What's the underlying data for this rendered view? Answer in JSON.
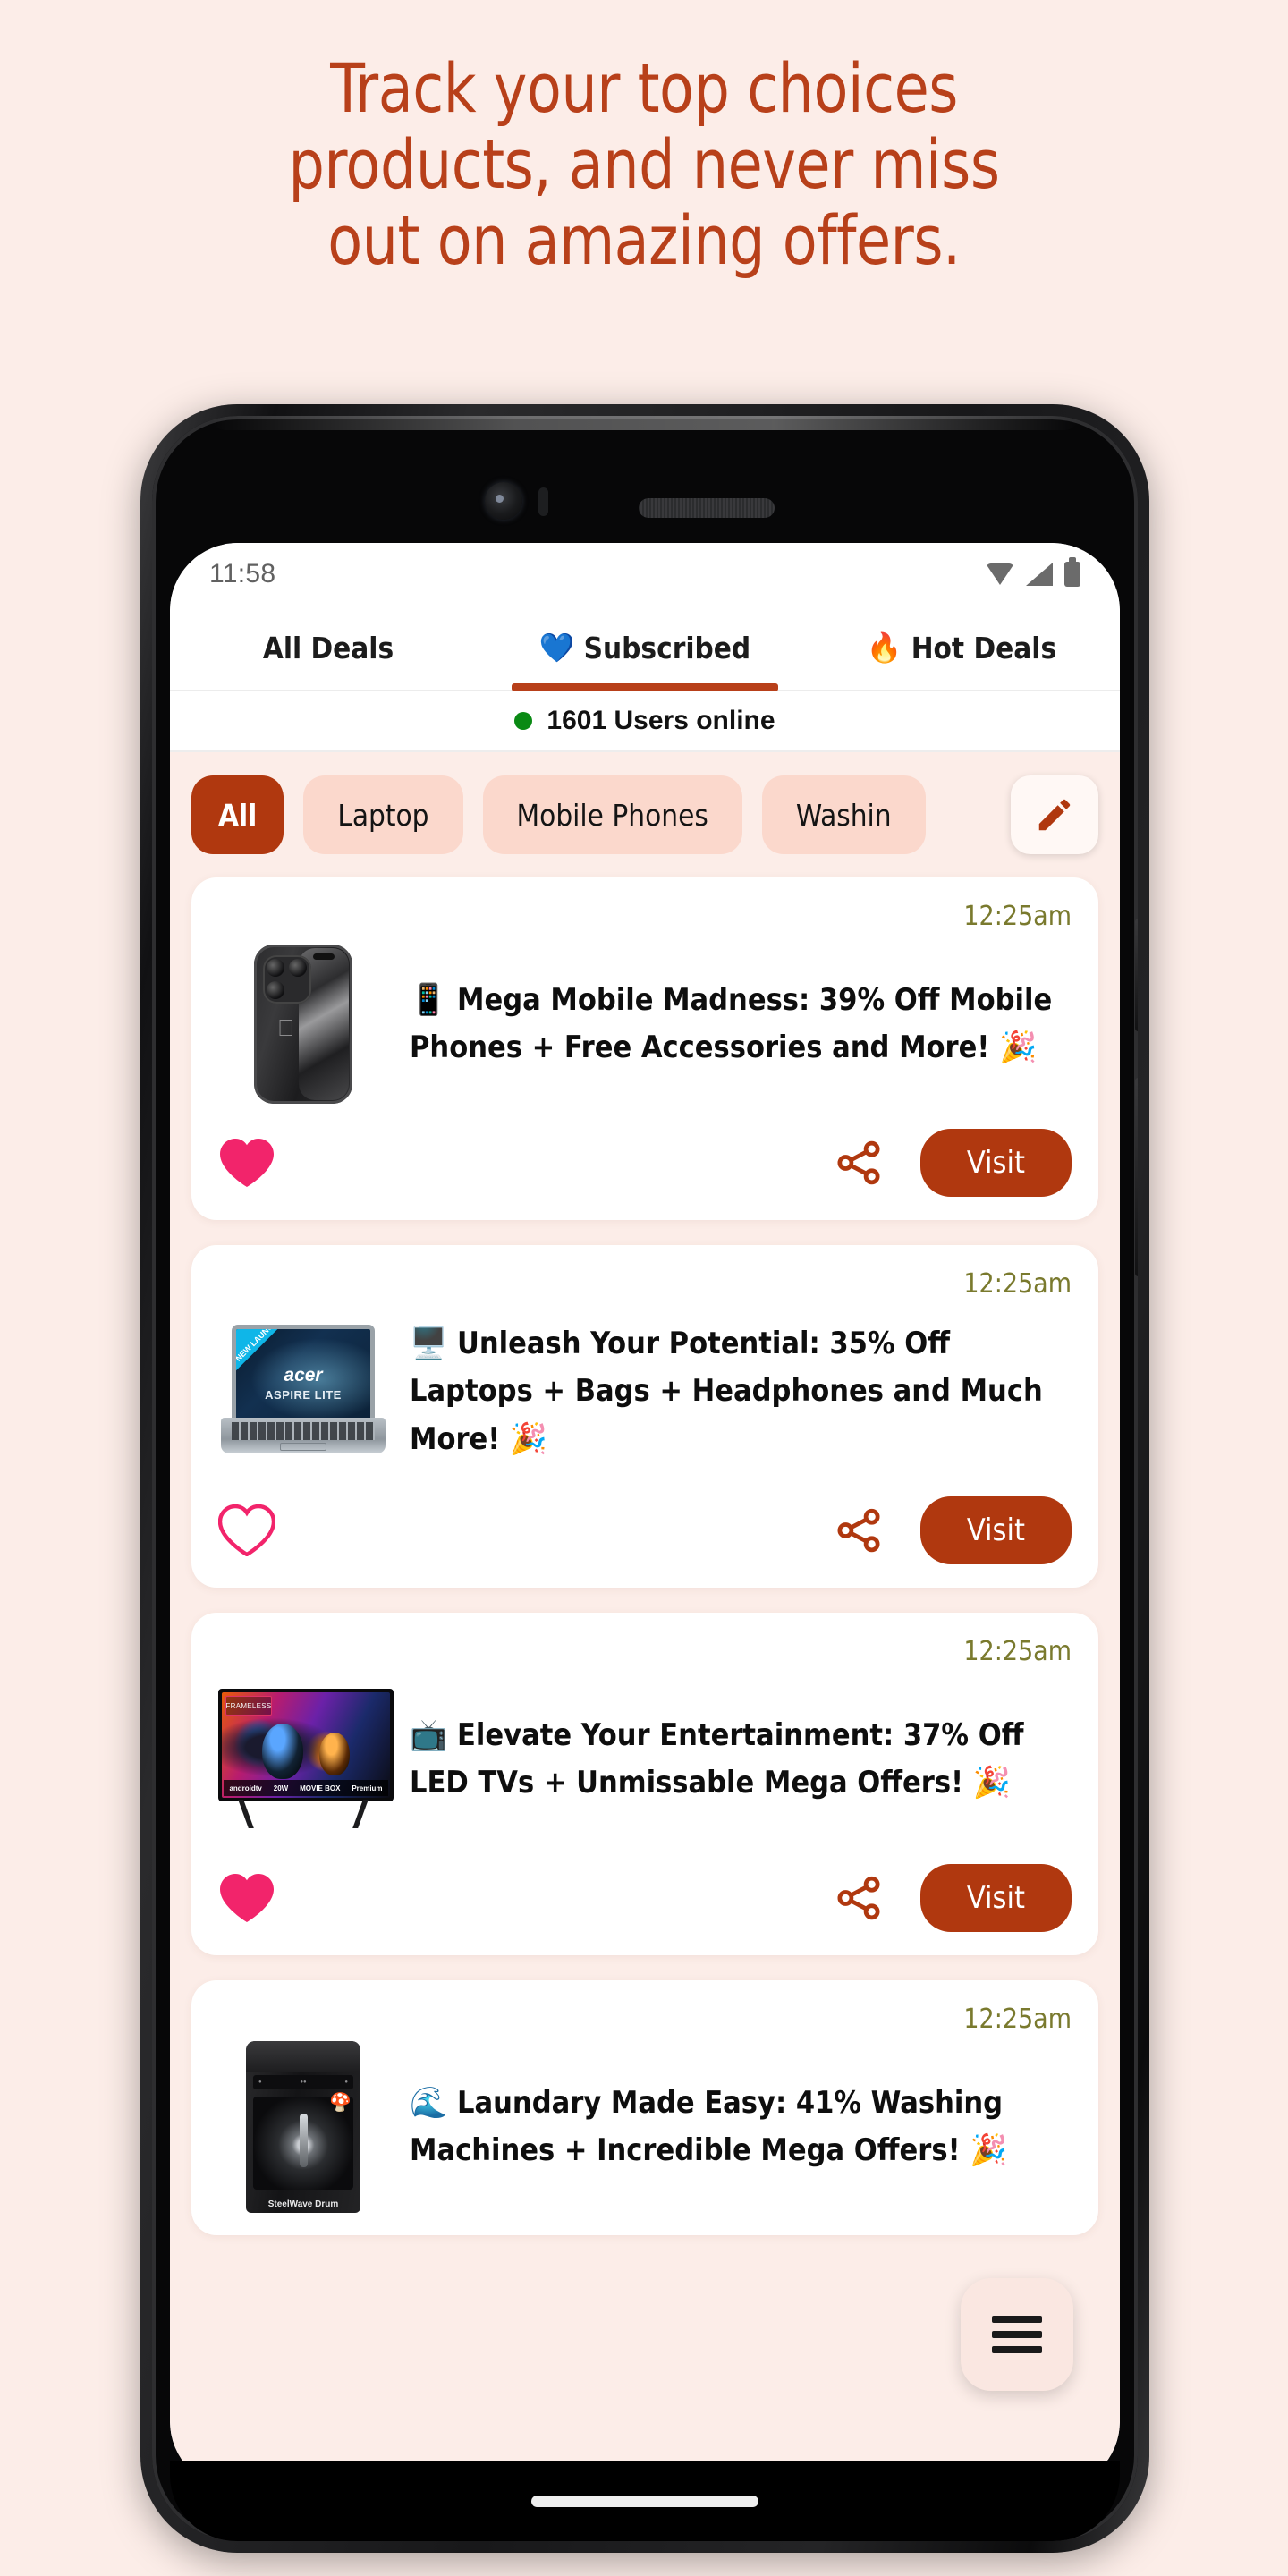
{
  "promo": {
    "headline_lines": [
      "Track your top choices",
      "products, and never miss",
      "out on amazing offers."
    ],
    "headline_color": "#B8401A",
    "background_color": "#FCEDE8"
  },
  "status_bar": {
    "time": "11:58",
    "icons": [
      "wifi-icon",
      "cellular-signal-icon",
      "battery-icon"
    ]
  },
  "tabs": [
    {
      "label": "All Deals",
      "emoji": "",
      "active": false
    },
    {
      "label": "Subscribed",
      "emoji": "💙",
      "active": true
    },
    {
      "label": "Hot Deals",
      "emoji": "🔥",
      "active": false
    }
  ],
  "online_status": {
    "text": "1601 Users online",
    "dot_color": "#0a8a14"
  },
  "chips": [
    {
      "label": "All",
      "active": true
    },
    {
      "label": "Laptop",
      "active": false
    },
    {
      "label": "Mobile Phones",
      "active": false
    },
    {
      "label": "Washin",
      "active": false
    }
  ],
  "chip_edit": {
    "icon": "pencil-icon",
    "color": "#B0380F"
  },
  "deals": [
    {
      "time": "12:25am",
      "emoji": "📱",
      "title": "Mega Mobile Madness: 39% Off Mobile Phones + Free Accessories and More! 🎉",
      "favorited": true,
      "visit_label": "Visit",
      "product": "iphone-15-pro-black-titanium"
    },
    {
      "time": "12:25am",
      "emoji": "🖥️",
      "title": "Unleash Your Potential: 35% Off Laptops + Bags + Headphones and Much More! 🎉",
      "favorited": false,
      "visit_label": "Visit",
      "product": "acer-aspire-lite-laptop",
      "product_badge": "NEW LAUNCH",
      "product_brand": "acer",
      "product_model": "ASPIRE LITE"
    },
    {
      "time": "12:25am",
      "emoji": "📺",
      "title": "Elevate Your Entertainment: 37% Off LED TVs + Unmissable Mega Offers! 🎉",
      "favorited": true,
      "visit_label": "Visit",
      "product": "led-television",
      "product_brand": "FRAMELESS",
      "product_features": [
        "androidtv",
        "20W",
        "MOVIE BOX",
        "Premium"
      ]
    },
    {
      "time": "12:25am",
      "emoji": "🌊",
      "title": "Laundary Made Easy: 41% Washing Machines + Incredible Mega Offers! 🎉",
      "favorited": false,
      "visit_label": "Visit",
      "product": "washing-machine",
      "product_model": "SteelWave Drum"
    }
  ],
  "fab": {
    "icon": "hamburger-menu-icon",
    "background": "#FAE7E1"
  },
  "theme": {
    "accent": "#B0380F",
    "chip_bg": "#FBD8CC",
    "heart_filled": "#F2246B",
    "share_color": "#B0380F",
    "time_color": "#7a7a2e"
  }
}
